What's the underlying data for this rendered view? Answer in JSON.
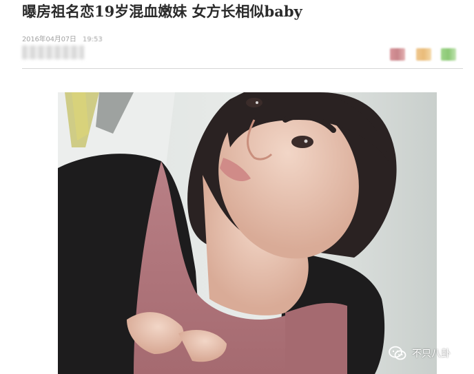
{
  "article": {
    "headline": "曝房祖名恋19岁混血嫩妹 女方长相似baby",
    "meta": {
      "date": "2016年04月07日",
      "time": "19:53"
    }
  },
  "share": {
    "icons": [
      "share-icon",
      "share-icon",
      "share-icon"
    ]
  },
  "photo": {
    "colors": {
      "wall": "#e6e8e6",
      "cardigan": "#1d1c1d",
      "top": "#b27a7e",
      "skin": "#e8c7b5",
      "hair": "#2a2222"
    }
  },
  "watermark": {
    "icon": "wechat-icon",
    "text": "不只八卦"
  }
}
